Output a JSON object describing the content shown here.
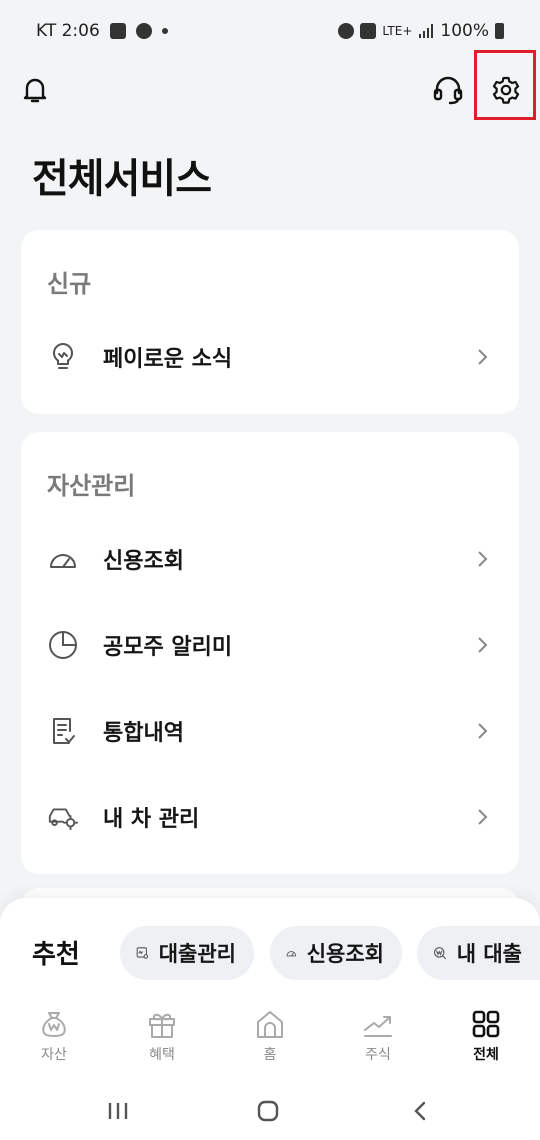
{
  "status_bar": {
    "carrier_time": "KT 2:06",
    "network": "LTE+",
    "battery": "100%"
  },
  "page": {
    "title": "전체서비스"
  },
  "sections": {
    "new": {
      "title": "신규",
      "items": [
        {
          "label": "페이로운 소식",
          "icon": "lightbulb-icon"
        }
      ]
    },
    "asset": {
      "title": "자산관리",
      "items": [
        {
          "label": "신용조회",
          "icon": "gauge-icon"
        },
        {
          "label": "공모주 알리미",
          "icon": "pie-chart-icon"
        },
        {
          "label": "통합내역",
          "icon": "document-check-icon"
        },
        {
          "label": "내 차 관리",
          "icon": "car-settings-icon"
        }
      ]
    }
  },
  "recommend": {
    "label": "추천",
    "chips": [
      {
        "label": "대출관리",
        "icon": "loan-icon"
      },
      {
        "label": "신용조회",
        "icon": "gauge-icon"
      },
      {
        "label": "내 대출",
        "icon": "search-won-icon"
      }
    ]
  },
  "tabs": [
    {
      "label": "자산",
      "icon": "money-bag-icon",
      "active": false
    },
    {
      "label": "혜택",
      "icon": "gift-icon",
      "active": false
    },
    {
      "label": "홈",
      "icon": "home-icon",
      "active": false
    },
    {
      "label": "주식",
      "icon": "chart-line-icon",
      "active": false
    },
    {
      "label": "전체",
      "icon": "grid-icon",
      "active": true
    }
  ],
  "colors": {
    "background": "#f3f4f6",
    "card": "#ffffff",
    "highlight": "#e11d2a",
    "chip": "#eef0f3"
  }
}
